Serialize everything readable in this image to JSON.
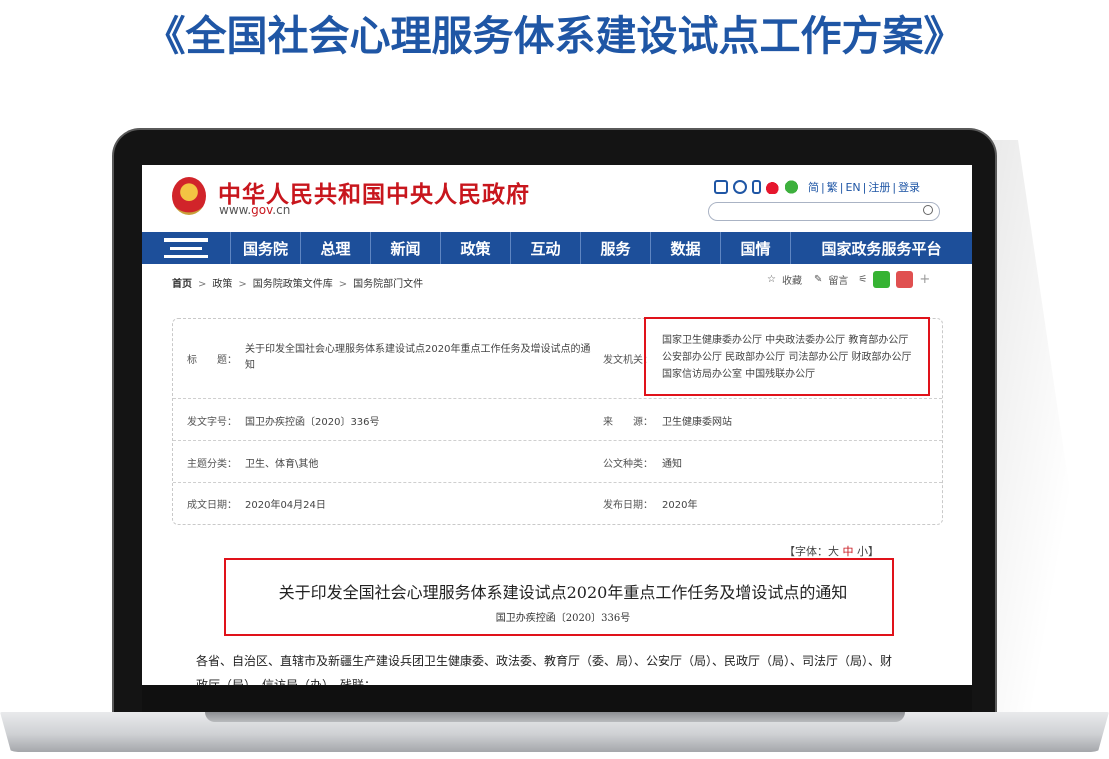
{
  "headline": "《全国社会心理服务体系建设试点工作方案》",
  "header": {
    "site_name": "中华人民共和国中央人民政府",
    "url_prefix": "www.",
    "url_domain": "gov",
    "url_suffix": ".cn",
    "links": [
      "简",
      "繁",
      "EN",
      "注册",
      "登录"
    ]
  },
  "nav": {
    "items": [
      "国务院",
      "总理",
      "新闻",
      "政策",
      "互动",
      "服务",
      "数据",
      "国情",
      "国家政务服务平台"
    ]
  },
  "breadcrumb": {
    "home": "首页",
    "items": [
      "政策",
      "国务院政策文件库",
      "国务院部门文件"
    ]
  },
  "share": {
    "favorite": "收藏",
    "comment": "留言",
    "plus": "+"
  },
  "info": {
    "title_label": "标　　题：",
    "title_value": "关于印发全国社会心理服务体系建设试点2020年重点工作任务及增设试点的通知",
    "issuer_label": "发文机关：",
    "issuer_lines": [
      "国家卫生健康委办公厅 中央政法委办公厅 教育部办公厅",
      "公安部办公厅 民政部办公厅 司法部办公厅 财政部办公厅",
      "国家信访局办公室 中国残联办公厅"
    ],
    "docno_label": "发文字号：",
    "docno_value": "国卫办疾控函〔2020〕336号",
    "source_label": "来　　源：",
    "source_value": "卫生健康委网站",
    "category_label": "主题分类：",
    "category_value": "卫生、体育\\其他",
    "type_label": "公文种类：",
    "type_value": "通知",
    "date_label": "成文日期：",
    "date_value": "2020年04月24日",
    "pub_label": "发布日期：",
    "pub_value": "2020年"
  },
  "font_ctrl": {
    "prefix": "【字体：",
    "large": "大",
    "medium": "中",
    "small": "小",
    "suffix": "】"
  },
  "document": {
    "title": "关于印发全国社会心理服务体系建设试点2020年重点工作任务及增设试点的通知",
    "number": "国卫办疾控函〔2020〕336号",
    "body_line1": "各省、自治区、直辖市及新疆生产建设兵团卫生健康委、政法委、教育厅（委、局）、公安厅（局）、民政厅（局）、司法厅（局）、财",
    "body_line2": "政厅（局）、信访局（办）、残联："
  },
  "colors": {
    "accent_blue": "#1d4f9a",
    "brand_red": "#c8161d",
    "highlight_red": "#e0121a"
  }
}
